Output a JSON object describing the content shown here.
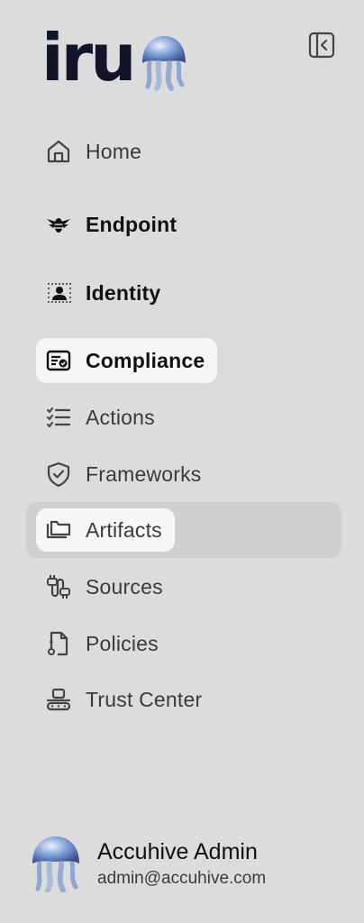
{
  "brand": {
    "name": "iru"
  },
  "nav": {
    "home": "Home",
    "endpoint": "Endpoint",
    "identity": "Identity",
    "compliance": "Compliance",
    "actions": "Actions",
    "frameworks": "Frameworks",
    "artifacts": "Artifacts",
    "sources": "Sources",
    "policies": "Policies",
    "trust_center": "Trust Center"
  },
  "user": {
    "name": "Accuhive Admin",
    "email": "admin@accuhive.com"
  },
  "icons": {
    "home": "home-icon",
    "endpoint": "bee-icon",
    "identity": "identity-icon",
    "compliance": "certificate-icon",
    "actions": "checklist-icon",
    "frameworks": "shield-check-icon",
    "artifacts": "folders-icon",
    "sources": "plug-icon",
    "policies": "document-icon",
    "trust_center": "trust-center-icon",
    "collapse": "sidebar-collapse-icon"
  },
  "colors": {
    "background": "#dcdcdc",
    "selected_pill": "#f7f7f7",
    "hover_row": "#cfcfcf",
    "brand_text": "#12152a"
  }
}
